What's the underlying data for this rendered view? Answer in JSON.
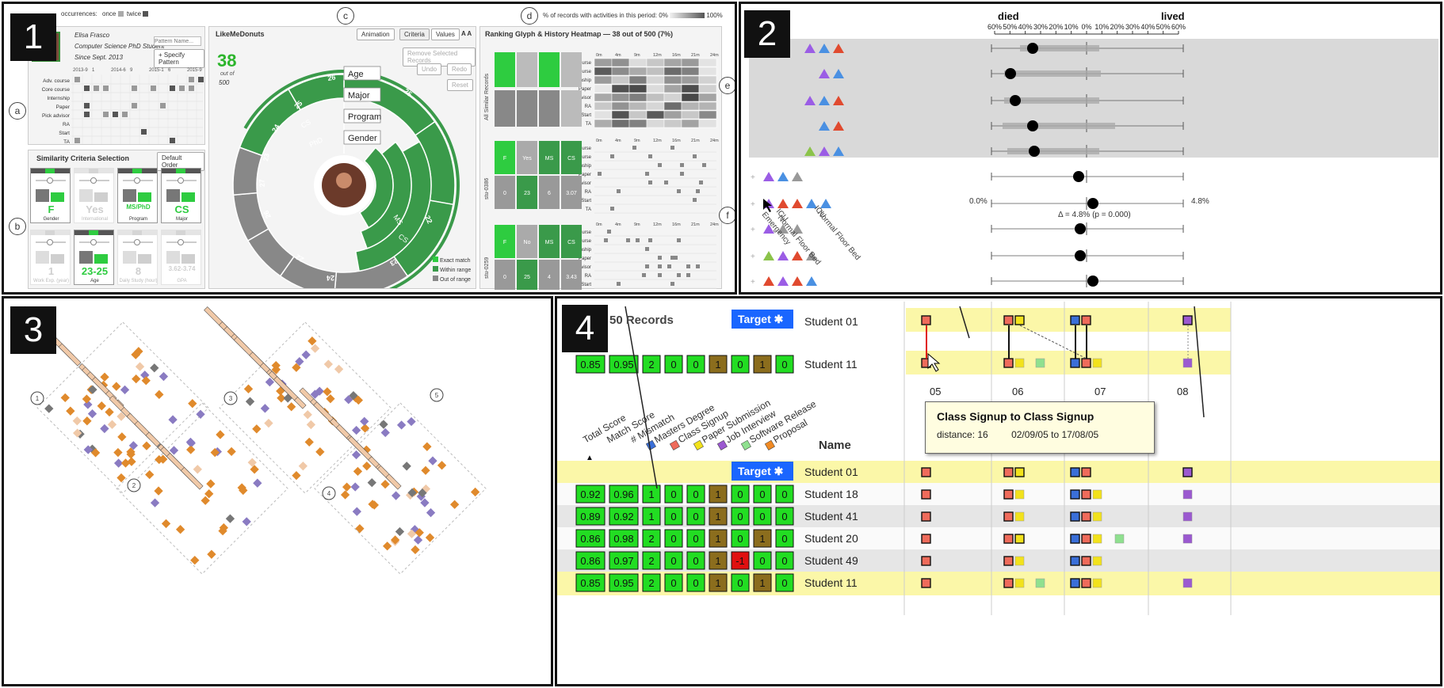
{
  "panels": [
    "1",
    "2",
    "3",
    "4"
  ],
  "p1": {
    "legend_occ_label": "occurrences:",
    "legend_once": "once",
    "legend_twice": "twice",
    "user_name": "Elisa Frasco",
    "user_role": "Computer Science PhD Student",
    "user_since": "Since Sept. 2013",
    "pattern_placeholder": "Pattern Name...",
    "specify_pattern": "+ Specify Pattern",
    "timeline_ticks": [
      "2013-9",
      "1",
      "2014-6",
      "9",
      "2015-1",
      "6",
      "2015-9"
    ],
    "activities": [
      "Adv. course",
      "Core course",
      "Internship",
      "Paper",
      "Pick advisor",
      "RA",
      "Start",
      "TA"
    ],
    "sim_title": "Similarity Criteria Selection",
    "default_order": "Default Order",
    "criteria_top": [
      {
        "value": "F",
        "label": "Gender",
        "active": true
      },
      {
        "value": "Yes",
        "label": "International",
        "active": false
      },
      {
        "value": "MS/PhD",
        "label": "Program",
        "active": true
      },
      {
        "value": "CS",
        "label": "Major",
        "active": true
      }
    ],
    "criteria_bottom": [
      {
        "value": "1",
        "label": "Work Exp. (year)",
        "active": false
      },
      {
        "value": "23-25",
        "label": "Age",
        "active": true
      },
      {
        "value": "8",
        "label": "Daily Study (hour)",
        "active": false
      },
      {
        "value": "3.62-3.74",
        "label": "GPA",
        "active": false
      }
    ],
    "donut_title": "LikeMeDonuts",
    "animation": "Animation",
    "criteria_btn": "Criteria",
    "values_btn": "Values",
    "font_btns": "A A",
    "remove_selected": "Remove Selected Records",
    "undo": "Undo",
    "redo": "Redo",
    "reset": "Reset",
    "count": "38",
    "count_out_of": "out of",
    "count_total": "500",
    "ring_labels": [
      "Age",
      "Major",
      "Program",
      "Gender"
    ],
    "ring_text": [
      "CS",
      "PhD",
      "CS",
      "MS"
    ],
    "segment_numbers": [
      "26",
      "25",
      "25",
      "24",
      "23",
      "22",
      "27",
      "26",
      "22",
      "23",
      "24"
    ],
    "legend_exact": "Exact match",
    "legend_within": "Within range",
    "legend_out": "Out of range",
    "heatmap_pct_label": "% of records with activities in this period:",
    "heatmap_pct_min": "0%",
    "heatmap_pct_max": "100%",
    "ranking_title": "Ranking Glyph & History Heatmap — 38 out of 500 (7%)",
    "heat_cols": [
      "0m",
      "4m",
      "9m",
      "12m",
      "16m",
      "21m",
      "24m",
      "28m"
    ],
    "all_similar": "All Similar Records",
    "rec1_id": "stu-0386",
    "rec2_id": "stu-0259",
    "rec1_glyph": [
      "F",
      "Yes",
      "MS",
      "CS",
      "0",
      "23",
      "6",
      "3.07"
    ],
    "rec2_glyph": [
      "F",
      "No",
      "MS",
      "CS",
      "0",
      "25",
      "4",
      "3.43"
    ],
    "callouts": [
      "a",
      "b",
      "c",
      "d",
      "e",
      "f"
    ]
  },
  "p2": {
    "died": "died",
    "lived": "lived",
    "axis_ticks": [
      "60%",
      "50%",
      "40%",
      "30%",
      "20%",
      "10%",
      "0%",
      "10%",
      "20%",
      "30%",
      "40%",
      "50%",
      "60%"
    ],
    "left_val": "0.0%",
    "right_val": "4.8%",
    "delta": "Δ = 4.8% (p = 0.000)",
    "rotated_labels": [
      "Emergency",
      "ICU",
      "Normal Floor Bed",
      "ICU",
      "Normal Floor Bed"
    ],
    "colors": {
      "purple": "#9b5de5",
      "blue": "#4a90e2",
      "red": "#e04a2f",
      "green": "#8bc34a",
      "gray": "#999999"
    }
  },
  "p3": {
    "markers": [
      "1",
      "2",
      "3",
      "4",
      "5"
    ],
    "colors": {
      "orange": "#e08a2c",
      "purple": "#8a7bc2",
      "peach": "#f0c9a8",
      "gray": "#777777"
    }
  },
  "p4": {
    "records_label": "50 Records",
    "target": "Target",
    "top_rows": [
      {
        "name": "Student 01",
        "scores": []
      },
      {
        "name": "Student 11",
        "scores": [
          "0.85",
          "0.95",
          "2",
          "0",
          "0",
          "1",
          "0",
          "1",
          "0"
        ]
      }
    ],
    "months": [
      "05",
      "06",
      "07",
      "08"
    ],
    "col_headers": [
      "Total Score",
      "Match Score",
      "# Mismatch",
      "Masters Degree",
      "Class Signup",
      "Paper Submission",
      "Job Interview",
      "Software Release",
      "Proposal"
    ],
    "name_header": "Name",
    "tooltip_title": "Class Signup to Class Signup",
    "tooltip_distance": "distance: 16",
    "tooltip_dates": "02/09/05 to 17/08/05",
    "rows": [
      {
        "name": "Student 01",
        "scores": [],
        "target": true
      },
      {
        "name": "Student 18",
        "scores": [
          "0.92",
          "0.96",
          "1",
          "0",
          "0",
          "1",
          "0",
          "0",
          "0"
        ]
      },
      {
        "name": "Student 41",
        "scores": [
          "0.89",
          "0.92",
          "1",
          "0",
          "0",
          "1",
          "0",
          "0",
          "0"
        ]
      },
      {
        "name": "Student 20",
        "scores": [
          "0.86",
          "0.98",
          "2",
          "0",
          "0",
          "1",
          "0",
          "1",
          "0"
        ]
      },
      {
        "name": "Student 49",
        "scores": [
          "0.86",
          "0.97",
          "2",
          "0",
          "0",
          "1",
          "-1",
          "0",
          "0"
        ]
      },
      {
        "name": "Student 11",
        "scores": [
          "0.85",
          "0.95",
          "2",
          "0",
          "0",
          "1",
          "0",
          "1",
          "0"
        ]
      }
    ],
    "colors": {
      "green": "#22dd22",
      "olive": "#8b6d1d",
      "red": "#e01010",
      "yellow_row": "#fbf7a8",
      "gray_row": "#e6e6e6"
    }
  }
}
